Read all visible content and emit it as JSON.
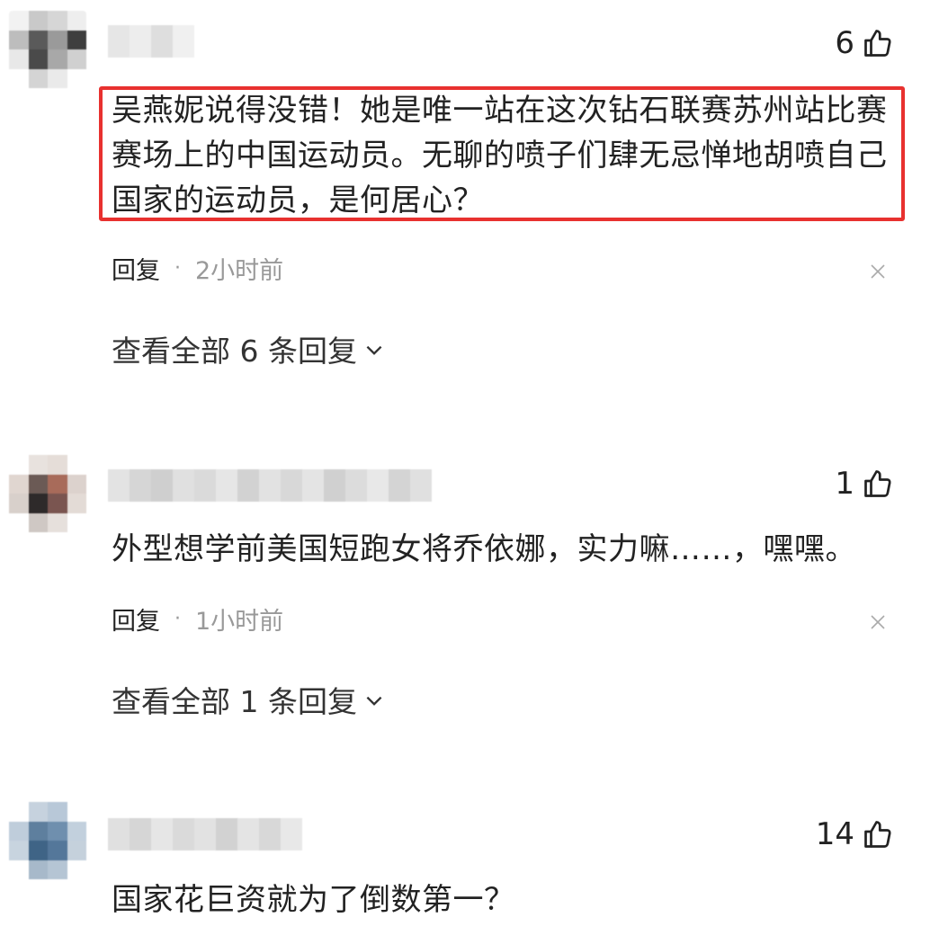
{
  "colors": {
    "highlight_border": "#e8312f",
    "meta_gray": "#999999",
    "text": "#222222"
  },
  "comments": [
    {
      "likes": "6",
      "text": "吴燕妮说得没错！她是唯一站在这次钻石联赛苏州站比赛赛场上的中国运动员。无聊的喷子们肆无忌惮地胡喷自己国家的运动员，是何居心？",
      "reply_label": "回复",
      "separator": "·",
      "time": "2小时前",
      "view_all": "查看全部 6 条回复",
      "highlighted": true
    },
    {
      "likes": "1",
      "text": "外型想学前美国短跑女将乔依娜，实力嘛……，嘿嘿。",
      "reply_label": "回复",
      "separator": "·",
      "time": "1小时前",
      "view_all": "查看全部 1 条回复",
      "highlighted": false
    },
    {
      "likes": "14",
      "text": "国家花巨资就为了倒数第一？",
      "highlighted": false
    }
  ],
  "icons": {
    "like": "thumbs-up-icon",
    "close": "close-icon",
    "expand": "chevron-down-icon"
  }
}
